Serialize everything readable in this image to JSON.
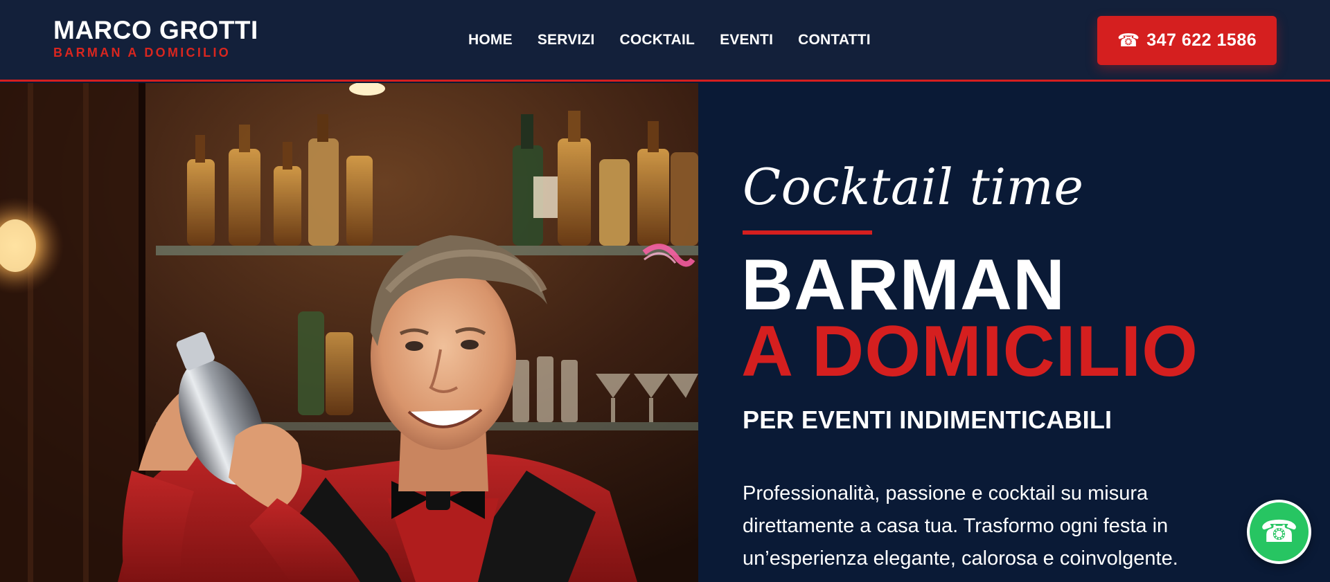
{
  "header": {
    "brand_name": "MARCO GROTTI",
    "brand_tagline": "BARMAN A DOMICILIO",
    "nav": [
      "HOME",
      "SERVIZI",
      "COCKTAIL",
      "EVENTI",
      "CONTATTI"
    ],
    "phone_icon": "phone-icon",
    "phone_label": "347 622 1586"
  },
  "hero": {
    "script_title": "Cocktail time",
    "headline_line1": "BARMAN",
    "headline_line2": "A DOMICILIO",
    "subheadline": "PER EVENTI INDIMENTICABILI",
    "body": "Professionalità, passione e cocktail su misura direttamente a casa tua. Trasformo ogni festa in un’esperienza elegante, calorosa e coinvolgente."
  },
  "floating": {
    "call_icon": "phone-icon"
  },
  "colors": {
    "header_bg": "#13203a",
    "hero_bg": "#0a1a36",
    "accent_red": "#d51f1f",
    "call_green": "#27c562"
  }
}
